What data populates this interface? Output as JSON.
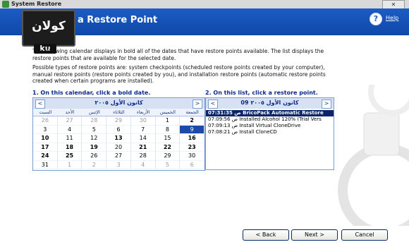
{
  "window": {
    "title": "System Restore",
    "close_label": "✕"
  },
  "header": {
    "title": "a Restore Point",
    "help": "Help"
  },
  "watermark": {
    "logo_text": "كولان",
    "logo_sub": "ku"
  },
  "description": {
    "para1": "The following calendar displays in bold all of the dates that have restore points available. The list displays the restore points that are available for the selected date.",
    "para2": "Possible types of restore points are: system checkpoints (scheduled restore points created by your computer), manual restore points (restore points created by you), and installation restore points (automatic restore points created when certain programs are installed)."
  },
  "steps": {
    "step1": "1. On this calendar, click a bold date.",
    "step2": "2. On this list, click a restore point."
  },
  "calendar": {
    "month": "كانون الأول ٢٠٠٥",
    "weekdays": [
      "الجمعة",
      "الخميس",
      "الأربعاء",
      "الثلاثاء",
      "الإثنين",
      "الأحد",
      "السبت"
    ],
    "weeks": [
      [
        {
          "d": "2",
          "s": "bold"
        },
        {
          "d": "1",
          "s": ""
        },
        {
          "d": "30",
          "s": "muted"
        },
        {
          "d": "29",
          "s": "muted"
        },
        {
          "d": "28",
          "s": "muted"
        },
        {
          "d": "27",
          "s": "muted"
        },
        {
          "d": "26",
          "s": "muted"
        }
      ],
      [
        {
          "d": "9",
          "s": "sel"
        },
        {
          "d": "8",
          "s": ""
        },
        {
          "d": "7",
          "s": ""
        },
        {
          "d": "6",
          "s": ""
        },
        {
          "d": "5",
          "s": ""
        },
        {
          "d": "4",
          "s": ""
        },
        {
          "d": "3",
          "s": ""
        }
      ],
      [
        {
          "d": "16",
          "s": "bold"
        },
        {
          "d": "15",
          "s": ""
        },
        {
          "d": "14",
          "s": ""
        },
        {
          "d": "13",
          "s": "bold"
        },
        {
          "d": "12",
          "s": ""
        },
        {
          "d": "11",
          "s": ""
        },
        {
          "d": "10",
          "s": "bold"
        }
      ],
      [
        {
          "d": "23",
          "s": "bold"
        },
        {
          "d": "22",
          "s": "bold"
        },
        {
          "d": "21",
          "s": "bold"
        },
        {
          "d": "20",
          "s": ""
        },
        {
          "d": "19",
          "s": "bold"
        },
        {
          "d": "18",
          "s": "bold"
        },
        {
          "d": "17",
          "s": "bold"
        }
      ],
      [
        {
          "d": "30",
          "s": ""
        },
        {
          "d": "29",
          "s": ""
        },
        {
          "d": "28",
          "s": ""
        },
        {
          "d": "27",
          "s": ""
        },
        {
          "d": "26",
          "s": ""
        },
        {
          "d": "25",
          "s": "bold"
        },
        {
          "d": "24",
          "s": "bold"
        }
      ],
      [
        {
          "d": "6",
          "s": "muted"
        },
        {
          "d": "5",
          "s": "muted"
        },
        {
          "d": "4",
          "s": "muted"
        },
        {
          "d": "3",
          "s": "muted"
        },
        {
          "d": "2",
          "s": "muted"
        },
        {
          "d": "1",
          "s": "muted"
        },
        {
          "d": "31",
          "s": ""
        }
      ]
    ]
  },
  "restore_list": {
    "date": "كانون الأول ٢٠٠٥ 09",
    "entries": [
      {
        "text": "07:31:35 ص BricoPack Automatic Restore",
        "selected": true
      },
      {
        "text": "07:09:56 ص Installed Alcohol 120% (Trial Vers",
        "selected": false
      },
      {
        "text": "07:09:13 ص Install Virtual CloneDrive",
        "selected": false
      },
      {
        "text": "07:08:21 ص Install CloneCD",
        "selected": false
      }
    ]
  },
  "buttons": {
    "back": "< Back",
    "next": "Next >",
    "cancel": "Cancel"
  }
}
